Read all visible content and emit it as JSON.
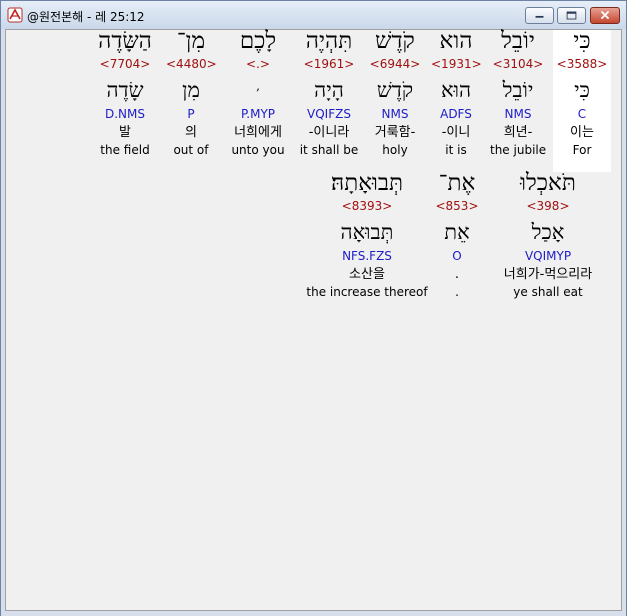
{
  "window": {
    "title": "@원전본해 - 레 25:12"
  },
  "colors": {
    "strong": "#a01010",
    "morph": "#1c1cc8",
    "highlight": "#ffffff",
    "background": "#f0f0f0"
  },
  "rows": [
    {
      "words": [
        {
          "hebrew": "כִּי",
          "strong": "<3588>",
          "lexeme": "כִּי",
          "morph": "C",
          "korean": "이는",
          "english": "For",
          "highlighted": true
        },
        {
          "hebrew": "יוֹבֵל",
          "strong": "<3104>",
          "lexeme": "יוֹבֵל",
          "morph": "NMS",
          "korean": "희년-",
          "english": "the jubile",
          "highlighted": false
        },
        {
          "hebrew": "הוא",
          "strong": "<1931>",
          "lexeme": "הוּא",
          "morph": "ADFS",
          "korean": "-이니",
          "english": "it is",
          "highlighted": false
        },
        {
          "hebrew": "קֹדֶשׁ",
          "strong": "<6944>",
          "lexeme": "קֹדֶשׁ",
          "morph": "NMS",
          "korean": "거룩함-",
          "english": "holy",
          "highlighted": false
        },
        {
          "hebrew": "תִּהְיֶה",
          "strong": "<1961>",
          "lexeme": "הָיָה",
          "morph": "VQIFZS",
          "korean": "-이니라",
          "english": "it shall be",
          "highlighted": false
        },
        {
          "hebrew": "לָכֶם",
          "strong": "<.>",
          "lexeme": ",",
          "morph": "P.MYP",
          "korean": "너희에게",
          "english": "unto you",
          "highlighted": false
        },
        {
          "hebrew": "מִן־",
          "strong": "<4480>",
          "lexeme": "מִן",
          "morph": "P",
          "korean": "의",
          "english": "out of",
          "highlighted": false
        },
        {
          "hebrew": "הַשָּׂדֶה",
          "strong": "<7704>",
          "lexeme": "שָׂדֶה",
          "morph": "D.NMS",
          "korean": "발",
          "english": "the field",
          "highlighted": false
        }
      ]
    },
    {
      "words": [
        {
          "hebrew": "תֹּאכְלוּ",
          "strong": "<398>",
          "lexeme": "אָכַל",
          "morph": "VQIMYP",
          "korean": "너희가-먹으리라",
          "english": "ye shall eat",
          "highlighted": false
        },
        {
          "hebrew": "אֶת־",
          "strong": "<853>",
          "lexeme": "אֵת",
          "morph": "O",
          "korean": ".",
          "english": ".",
          "highlighted": false
        },
        {
          "hebrew": "תְּבוּאָתָהּ׃",
          "strong": "<8393>",
          "lexeme": "תְּבוּאָה",
          "morph": "NFS.FZS",
          "korean": "소산을",
          "english": "the increase thereof",
          "highlighted": false
        }
      ]
    }
  ]
}
